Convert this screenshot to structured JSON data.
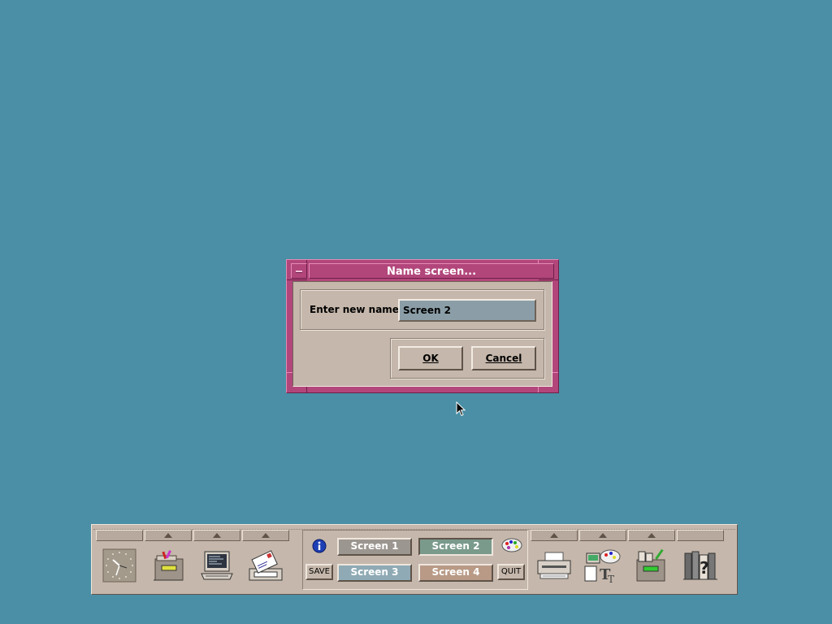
{
  "dialog": {
    "title": "Name screen...",
    "label": "Enter new name :",
    "input_value": "Screen 2",
    "ok_label": "OK",
    "cancel_label": "Cancel"
  },
  "panel": {
    "workspaces": [
      {
        "label": "Screen 1"
      },
      {
        "label": "Screen 2",
        "selected": true
      },
      {
        "label": "Screen 3"
      },
      {
        "label": "Screen 4"
      }
    ],
    "save_label": "SAVE",
    "quit_label": "QUIT",
    "icons": [
      "clock-icon",
      "file-manager-icon",
      "terminal-icon",
      "mail-icon",
      "info-icon",
      "style-manager-icon",
      "printer-icon",
      "application-manager-icon",
      "text-editor-icon",
      "help-manager-icon"
    ]
  },
  "colors": {
    "desktop": "#4a8fa5",
    "dialog_frame": "#b2467b",
    "panel": "#c5b7ab"
  }
}
